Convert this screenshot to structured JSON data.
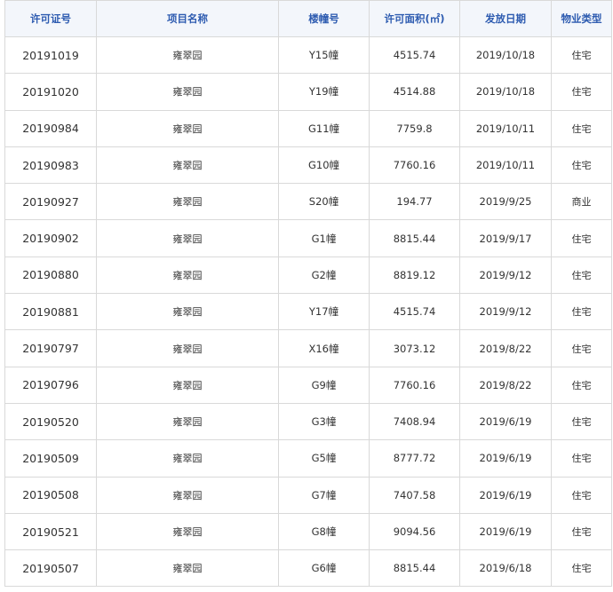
{
  "table": {
    "headers": [
      "许可证号",
      "项目名称",
      "楼幢号",
      "许可面积(㎡)",
      "发放日期",
      "物业类型"
    ],
    "rows": [
      [
        "20191019",
        "雍翠园",
        "Y15幢",
        "4515.74",
        "2019/10/18",
        "住宅"
      ],
      [
        "20191020",
        "雍翠园",
        "Y19幢",
        "4514.88",
        "2019/10/18",
        "住宅"
      ],
      [
        "20190984",
        "雍翠园",
        "G11幢",
        "7759.8",
        "2019/10/11",
        "住宅"
      ],
      [
        "20190983",
        "雍翠园",
        "G10幢",
        "7760.16",
        "2019/10/11",
        "住宅"
      ],
      [
        "20190927",
        "雍翠园",
        "S20幢",
        "194.77",
        "2019/9/25",
        "商业"
      ],
      [
        "20190902",
        "雍翠园",
        "G1幢",
        "8815.44",
        "2019/9/17",
        "住宅"
      ],
      [
        "20190880",
        "雍翠园",
        "G2幢",
        "8819.12",
        "2019/9/12",
        "住宅"
      ],
      [
        "20190881",
        "雍翠园",
        "Y17幢",
        "4515.74",
        "2019/9/12",
        "住宅"
      ],
      [
        "20190797",
        "雍翠园",
        "X16幢",
        "3073.12",
        "2019/8/22",
        "住宅"
      ],
      [
        "20190796",
        "雍翠园",
        "G9幢",
        "7760.16",
        "2019/8/22",
        "住宅"
      ],
      [
        "20190520",
        "雍翠园",
        "G3幢",
        "7408.94",
        "2019/6/19",
        "住宅"
      ],
      [
        "20190509",
        "雍翠园",
        "G5幢",
        "8777.72",
        "2019/6/19",
        "住宅"
      ],
      [
        "20190508",
        "雍翠园",
        "G7幢",
        "7407.58",
        "2019/6/19",
        "住宅"
      ],
      [
        "20190521",
        "雍翠园",
        "G8幢",
        "9094.56",
        "2019/6/19",
        "住宅"
      ],
      [
        "20190507",
        "雍翠园",
        "G6幢",
        "8815.44",
        "2019/6/18",
        "住宅"
      ]
    ]
  },
  "colors": {
    "header_text": "#2d5bb0",
    "header_bg": "#f3f6fb",
    "cell_text": "#333333",
    "border": "#d9d9d9"
  }
}
